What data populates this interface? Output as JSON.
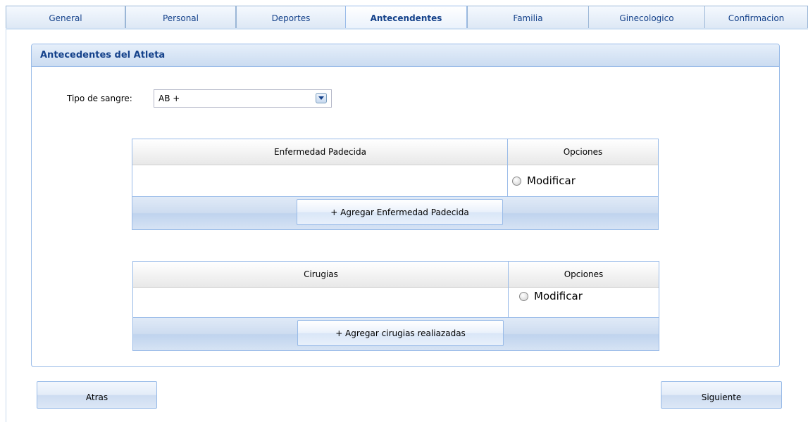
{
  "tabs": [
    {
      "label": "General"
    },
    {
      "label": "Personal"
    },
    {
      "label": "Deportes"
    },
    {
      "label": "Antecendentes"
    },
    {
      "label": "Familia"
    },
    {
      "label": "Ginecologico"
    },
    {
      "label": "Confirmacion"
    }
  ],
  "panel": {
    "title": "Antecedentes del Atleta",
    "blood_type": {
      "label": "Tipo de sangre:",
      "value": "AB +"
    }
  },
  "grid_enfermedad": {
    "columns": [
      "Enfermedad Padecida",
      "Opciones"
    ],
    "option_label": "Modificar",
    "add_button": "+ Agregar Enfermedad Padecida"
  },
  "grid_cirugias": {
    "columns": [
      "Cirugias",
      "Opciones"
    ],
    "option_label": "Modificar",
    "add_button": "+ Agregar cirugias realiazadas"
  },
  "nav": {
    "back": "Atras",
    "next": "Siguiente"
  },
  "colors": {
    "accent": "#15428b",
    "border": "#99bbe8"
  }
}
